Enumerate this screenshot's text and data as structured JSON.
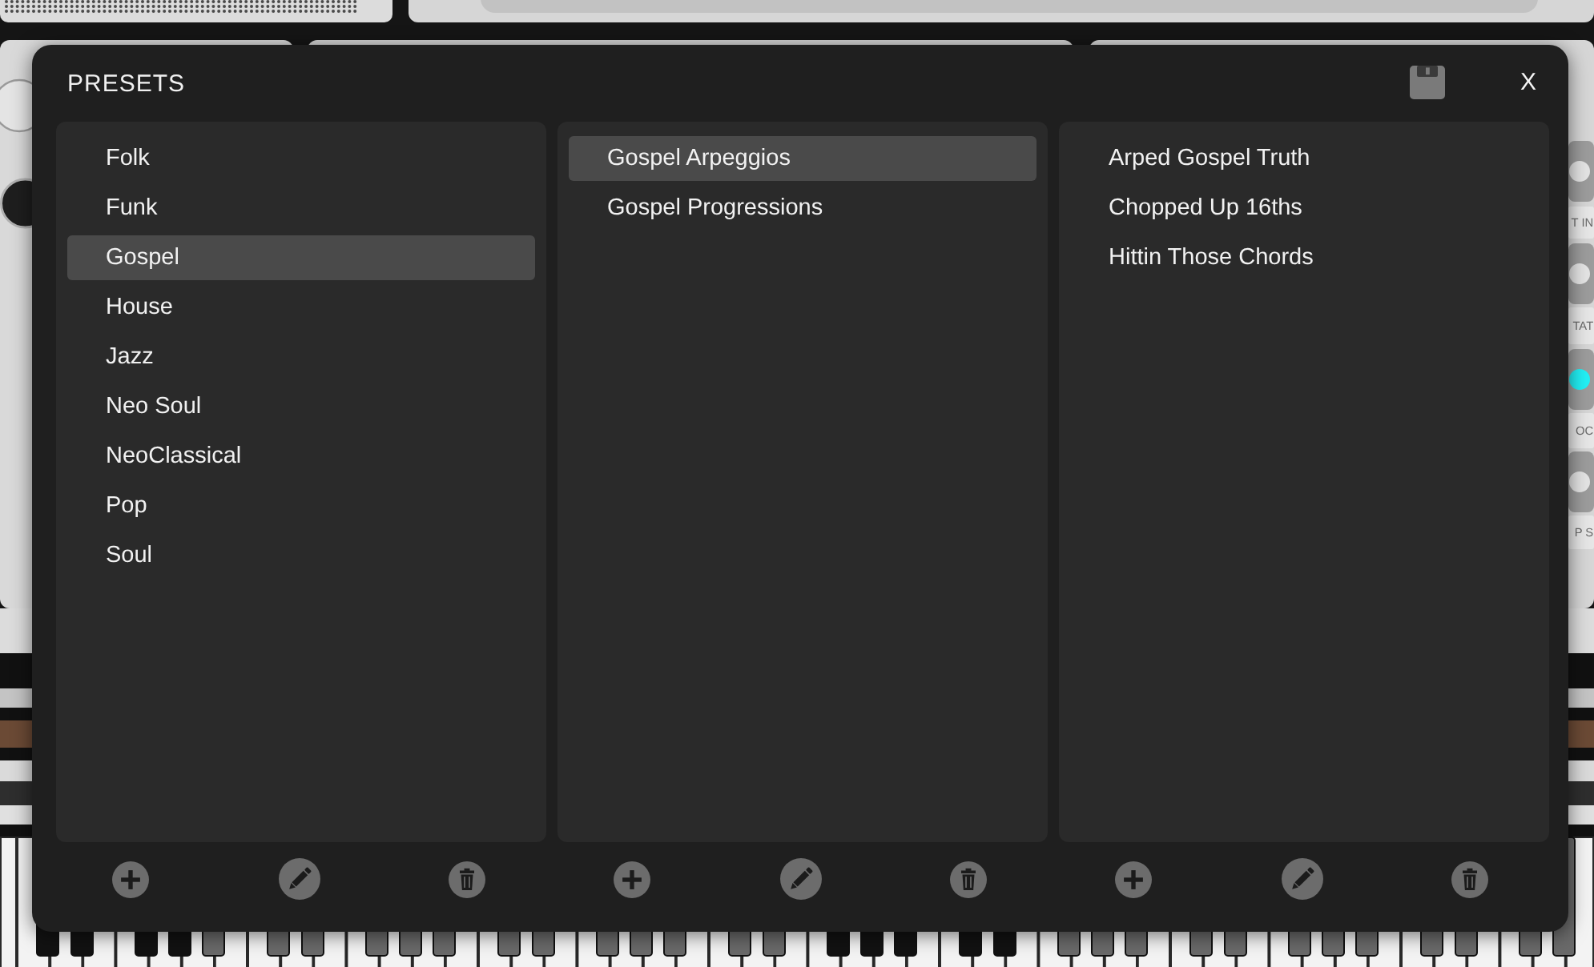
{
  "dialog": {
    "title": "PRESETS",
    "close_button": {
      "label": "X"
    }
  },
  "columns": [
    {
      "items": [
        {
          "label": "Folk",
          "selected": false
        },
        {
          "label": "Funk",
          "selected": false
        },
        {
          "label": "Gospel",
          "selected": true
        },
        {
          "label": "House",
          "selected": false
        },
        {
          "label": "Jazz",
          "selected": false
        },
        {
          "label": "Neo Soul",
          "selected": false
        },
        {
          "label": "NeoClassical",
          "selected": false
        },
        {
          "label": "Pop",
          "selected": false
        },
        {
          "label": "Soul",
          "selected": false
        }
      ]
    },
    {
      "items": [
        {
          "label": "Gospel Arpeggios",
          "selected": true
        },
        {
          "label": "Gospel Progressions",
          "selected": false
        }
      ]
    },
    {
      "items": [
        {
          "label": "Arped Gospel Truth",
          "selected": false
        },
        {
          "label": "Chopped Up 16ths",
          "selected": false
        },
        {
          "label": "Hittin Those Chords",
          "selected": false
        }
      ]
    }
  ],
  "background": {
    "side_labels": [
      "T IN",
      "TAT",
      "OC",
      "P S"
    ]
  }
}
